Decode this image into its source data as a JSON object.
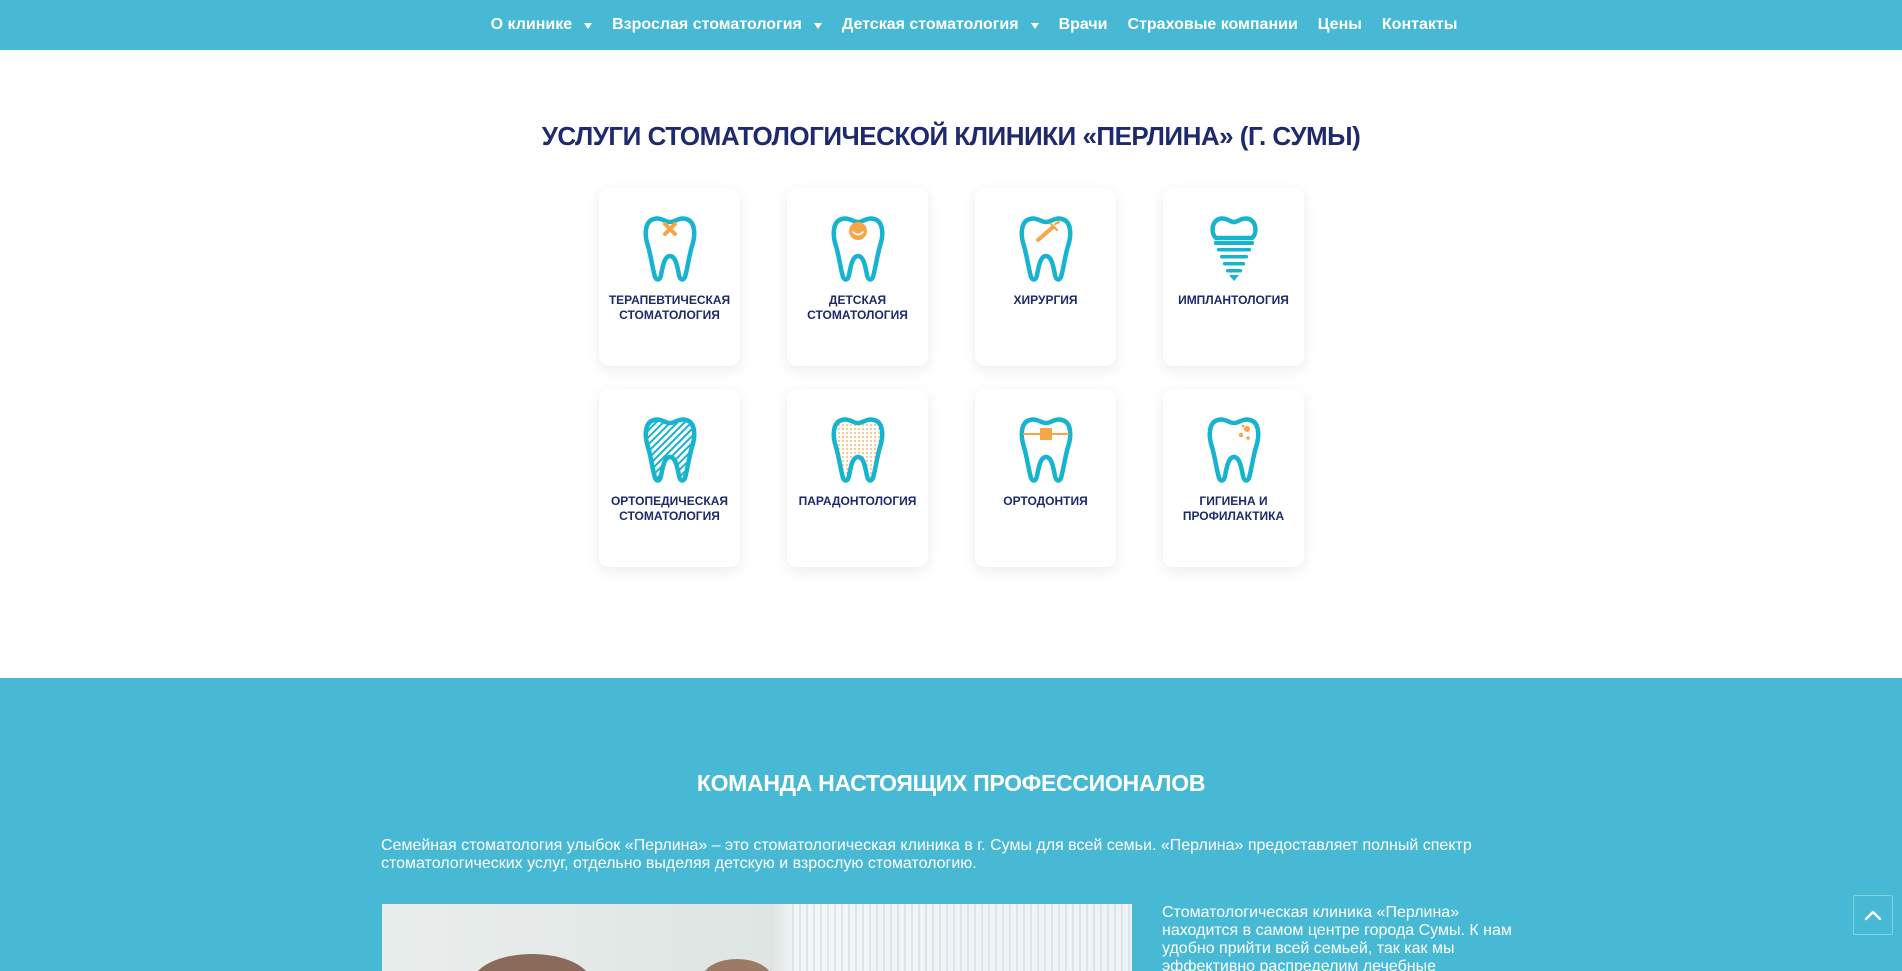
{
  "nav": {
    "items": [
      {
        "label": "О клинике",
        "dropdown": true
      },
      {
        "label": "Взрослая стоматология",
        "dropdown": true
      },
      {
        "label": "Детская стоматология",
        "dropdown": true
      },
      {
        "label": "Врачи",
        "dropdown": false
      },
      {
        "label": "Страховые компании",
        "dropdown": false
      },
      {
        "label": "Цены",
        "dropdown": false
      },
      {
        "label": "Контакты",
        "dropdown": false
      }
    ]
  },
  "services": {
    "title": "УСЛУГИ СТОМАТОЛОГИЧЕСКОЙ КЛИНИКИ «ПЕРЛИНА» (Г. СУМЫ)",
    "cards": [
      {
        "label": "ТЕРАПЕВТИЧЕСКАЯ СТОМАТОЛОГИЯ",
        "icon": "tooth-therapy-icon"
      },
      {
        "label": "ДЕТСКАЯ СТОМАТОЛОГИЯ",
        "icon": "tooth-kids-icon"
      },
      {
        "label": "ХИРУРГИЯ",
        "icon": "tooth-surgery-icon"
      },
      {
        "label": "ИМПЛАНТОЛОГИЯ",
        "icon": "tooth-implant-icon"
      },
      {
        "label": "ОРТОПЕДИЧЕСКАЯ СТОМАТОЛОГИЯ",
        "icon": "tooth-orthopedic-icon"
      },
      {
        "label": "ПАРАДОНТОЛОГИЯ",
        "icon": "tooth-periodontal-icon"
      },
      {
        "label": "ОРТОДОНТИЯ",
        "icon": "tooth-braces-icon"
      },
      {
        "label": "ГИГИЕНА И ПРОФИЛАКТИКА",
        "icon": "tooth-hygiene-icon"
      }
    ]
  },
  "team": {
    "title": "КОМАНДА НАСТОЯЩИХ ПРОФЕССИОНАЛОВ",
    "intro": "Семейная стоматология улыбок «Перлина» – это стоматологическая клиника в г. Сумы для всей семьи. «Перлина» предоставляет полный спектр стоматологических услуг, отдельно выделяя детскую и взрослую стоматологию.",
    "side_text": "Стоматологическая клиника «Перлина» находится в самом центре города Сумы. К нам удобно прийти всей семьей, так как мы эффективно распределим лечебные"
  },
  "colors": {
    "accent": "#48b9d5",
    "title_navy": "#1e2a6b",
    "icon_cyan": "#16b4cf",
    "icon_orange": "#f7a546"
  },
  "scroll_top_icon": "chevron-up-icon"
}
